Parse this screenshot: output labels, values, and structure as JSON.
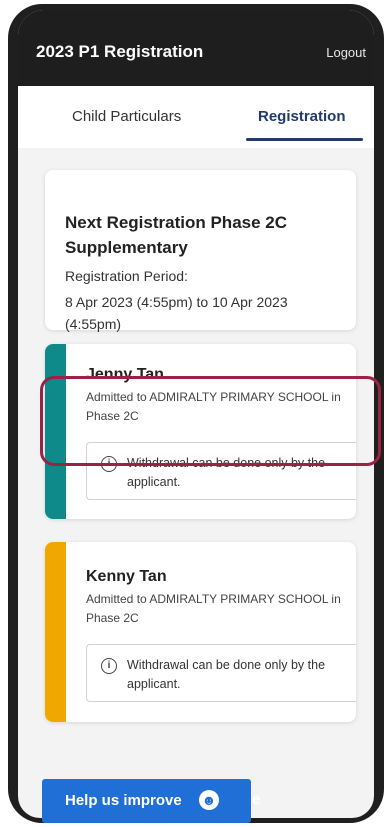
{
  "appbar": {
    "title": "2023 P1 Registration",
    "logout_label": "Logout"
  },
  "tabs": [
    {
      "label": "Child Particulars",
      "active": false
    },
    {
      "label": "Registration",
      "active": true
    }
  ],
  "phase_card": {
    "title": "Next Registration Phase 2C Supplementary",
    "period_label": "Registration Period:",
    "period_dates": "8 Apr 2023 (4:55pm) to 10 Apr 2023 (4:55pm)"
  },
  "children": [
    {
      "name": "Jenny Tan",
      "status": "Admitted to ADMIRALTY PRIMARY SCHOOL in Phase 2C",
      "notice": "Withdrawal can be done only by the applicant.",
      "stripe_color": "#0f8a8a"
    },
    {
      "name": "Kenny Tan",
      "status": "Admitted to ADMIRALTY PRIMARY SCHOOL in Phase 2C",
      "notice": "Withdrawal can be done only by the applicant.",
      "stripe_color": "#f0a800"
    }
  ],
  "feedback": {
    "label": "Help us improve",
    "trailing_glyph": "e"
  },
  "colors": {
    "highlight": "#9b2244",
    "primary": "#1f3a6b",
    "help_button": "#1f6fd6"
  }
}
